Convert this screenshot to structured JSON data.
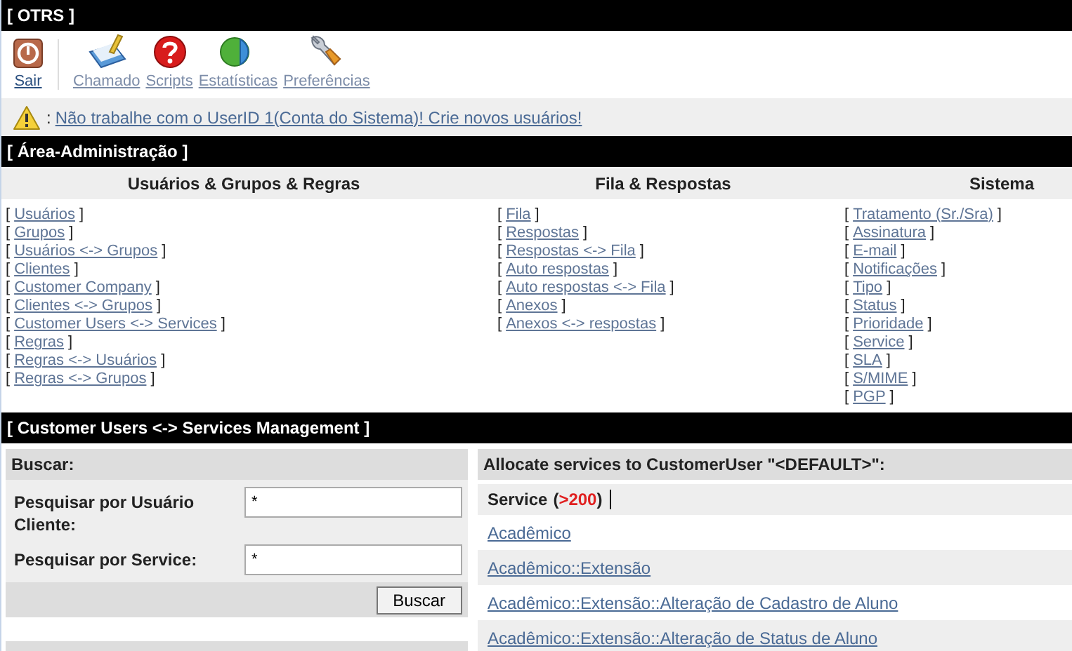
{
  "window": {
    "title": "[ OTRS ]"
  },
  "toolbar": [
    {
      "kind": "power",
      "label": "Sair",
      "dimmed": false
    },
    {
      "kind": "notepad",
      "label": "Chamado",
      "dimmed": true
    },
    {
      "kind": "question",
      "label": "Scripts",
      "dimmed": true
    },
    {
      "kind": "pie",
      "label": "Estatísticas",
      "dimmed": true
    },
    {
      "kind": "wrench",
      "label": "Preferências",
      "dimmed": true
    }
  ],
  "notice": {
    "separator": ":",
    "link": "Não trabalhe com o UserID 1(Conta do Sistema)! Crie novos usuários!"
  },
  "admin": {
    "title": "[ Área-Administração ]",
    "columns": [
      {
        "heading": "Usuários & Grupos & Regras",
        "links": [
          {
            "pre": "[",
            "link": "Usuários",
            "post": "]"
          },
          {
            "pre": "[",
            "link": "Grupos",
            "post": "]"
          },
          {
            "pre": "[",
            "link": "Usuários <-> Grupos",
            "post": "]"
          },
          {
            "pre": "[",
            "link": "Clientes",
            "post": "]"
          },
          {
            "pre": "[",
            "link": "Customer Company",
            "post": "]"
          },
          {
            "pre": "[",
            "link": "Clientes <-> Grupos",
            "post": "]"
          },
          {
            "pre": "[",
            "link": "Customer Users <-> Services",
            "post": "]"
          },
          {
            "pre": "[",
            "link": "Regras",
            "post": "]"
          },
          {
            "pre": "[",
            "link": "Regras <-> Usuários",
            "post": "]"
          },
          {
            "pre": "[",
            "link": "Regras <-> Grupos",
            "post": "]"
          }
        ]
      },
      {
        "heading": "Fila & Respostas",
        "links": [
          {
            "pre": "[",
            "link": "Fila",
            "post": "]"
          },
          {
            "pre": "[",
            "link": "Respostas",
            "post": "]"
          },
          {
            "pre": "[",
            "link": "Respostas <-> Fila",
            "post": "]"
          },
          {
            "pre": "[",
            "link": "Auto respostas",
            "post": "]"
          },
          {
            "pre": "[",
            "link": "Auto respostas <-> Fila",
            "post": "]"
          },
          {
            "pre": "[",
            "link": "Anexos",
            "post": "]"
          },
          {
            "pre": "[",
            "link": "Anexos <-> respostas",
            "post": "]"
          }
        ]
      },
      {
        "heading": "Sistema",
        "links": [
          {
            "pre": "[",
            "link": "Tratamento (Sr./Sra)",
            "post": "]"
          },
          {
            "pre": "[",
            "link": "Assinatura",
            "post": "]"
          },
          {
            "pre": "[",
            "link": "E-mail",
            "post": "]"
          },
          {
            "pre": "[",
            "link": "Notificações",
            "post": "]"
          },
          {
            "pre": "[",
            "link": "Tipo",
            "post": "]"
          },
          {
            "pre": "[",
            "link": "Status",
            "post": "]"
          },
          {
            "pre": "[",
            "link": "Prioridade",
            "post": "]"
          },
          {
            "pre": "[",
            "link": "Service",
            "post": "]"
          },
          {
            "pre": "[",
            "link": "SLA",
            "post": "]"
          },
          {
            "pre": "[",
            "link": "S/MIME",
            "post": "]"
          },
          {
            "pre": "[",
            "link": "PGP",
            "post": "]"
          }
        ]
      }
    ]
  },
  "management": {
    "title": "[ Customer Users <-> Services Management ]",
    "search": {
      "title": "Buscar:",
      "fields": [
        {
          "label": "Pesquisar por Usuário Cliente:",
          "value": "*"
        },
        {
          "label": "Pesquisar por Service:",
          "value": "*"
        }
      ],
      "button": "Buscar"
    },
    "allocate": {
      "title": "Allocate services to CustomerUser \"<DEFAULT>\":",
      "header": {
        "label": "Service",
        "open": "(",
        "count": ">200",
        "close": ")"
      },
      "services": [
        "Acadêmico",
        "Acadêmico::Extensão",
        "Acadêmico::Extensão::Alteração de Cadastro de Aluno",
        "Acadêmico::Extensão::Alteração de Status de Aluno"
      ]
    }
  }
}
